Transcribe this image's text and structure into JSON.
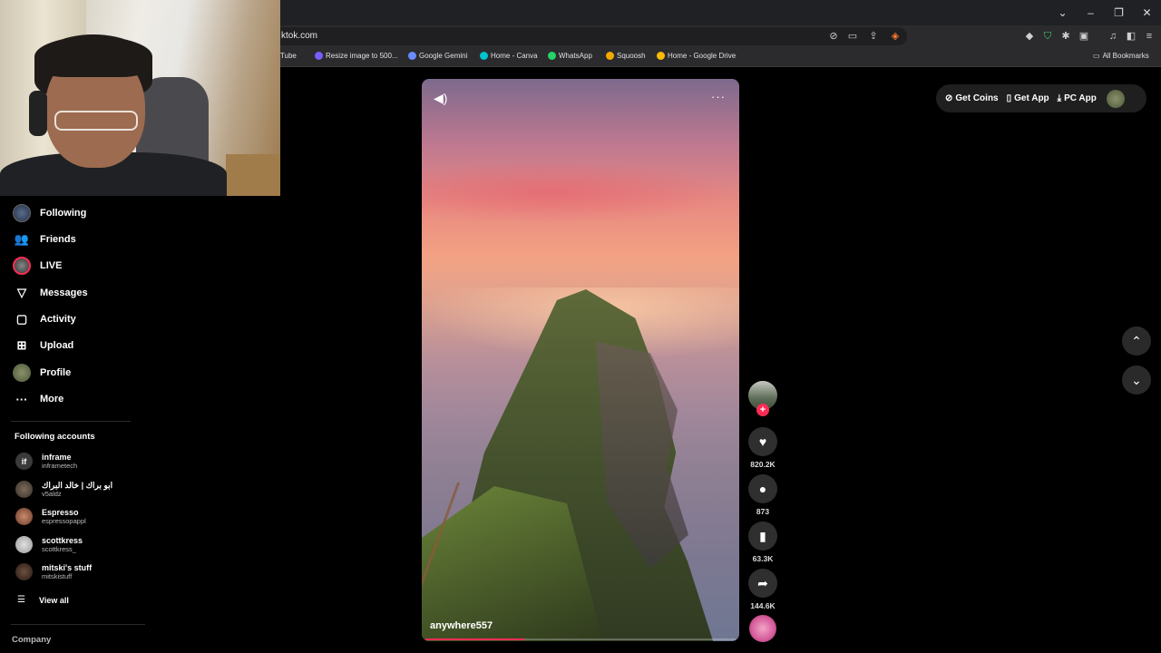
{
  "browser": {
    "url": "ktok.com",
    "window_controls": [
      "⌄",
      "–",
      "❐",
      "✕"
    ],
    "bookmarks": [
      {
        "label": "ouTube",
        "color": "#ff0000"
      },
      {
        "label": "Resize image to 500...",
        "color": "#7b5cff"
      },
      {
        "label": "Google Gemini",
        "color": "#6a8cff"
      },
      {
        "label": "Home - Canva",
        "color": "#00c4cc"
      },
      {
        "label": "WhatsApp",
        "color": "#25d366"
      },
      {
        "label": "Squoosh",
        "color": "#f2a900"
      },
      {
        "label": "Home - Google Drive",
        "color": "#fbbc04"
      }
    ],
    "all_bookmarks": "All Bookmarks"
  },
  "sidebar": {
    "nav": [
      {
        "label": "Following",
        "icon": "following-avatar-icon"
      },
      {
        "label": "Friends",
        "icon": "friends-icon"
      },
      {
        "label": "LIVE",
        "icon": "live-icon"
      },
      {
        "label": "Messages",
        "icon": "messages-icon"
      },
      {
        "label": "Activity",
        "icon": "activity-icon"
      },
      {
        "label": "Upload",
        "icon": "upload-icon"
      },
      {
        "label": "Profile",
        "icon": "profile-avatar-icon"
      },
      {
        "label": "More",
        "icon": "more-icon"
      }
    ],
    "following_title": "Following accounts",
    "accounts": [
      {
        "name": "inframe",
        "handle": "inframetech"
      },
      {
        "name": "ابو براك | خالد البراك",
        "handle": "v5aldz"
      },
      {
        "name": "Espresso",
        "handle": "espressopappl"
      },
      {
        "name": "scottkress",
        "handle": "scottkress_"
      },
      {
        "name": "mitski's stuff",
        "handle": "mitskistuff"
      }
    ],
    "view_all": "View all",
    "company": "Company"
  },
  "video": {
    "author": "anywhere557",
    "progress": 0.32
  },
  "actions": {
    "likes": "820.2K",
    "comments": "873",
    "saves": "63.3K",
    "shares": "144.6K"
  },
  "top_bar": {
    "get_coins": "Get Coins",
    "get_app": "Get App",
    "pc_app": "PC App"
  },
  "colors": {
    "accent": "#fe2c55",
    "background": "#000000"
  }
}
